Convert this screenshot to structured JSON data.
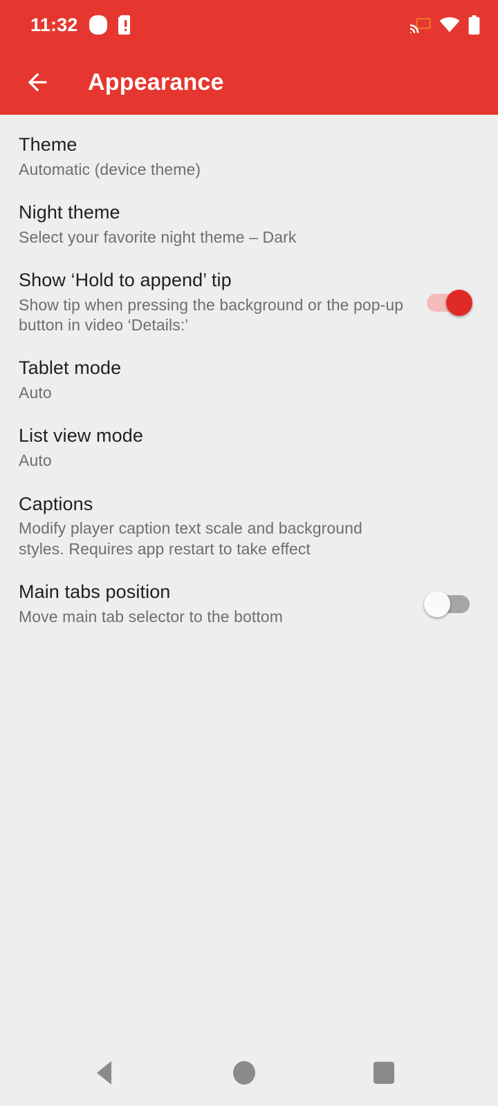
{
  "status_bar": {
    "time": "11:32",
    "icons_left": [
      "notification-blob-icon",
      "sdcard-alert-icon"
    ],
    "icons_right": [
      "cast-icon",
      "wifi-icon",
      "battery-icon"
    ],
    "background_color": "#e5372f",
    "cast_accent_color": "#f0702a"
  },
  "toolbar": {
    "back_icon": "arrow-left-icon",
    "title": "Appearance",
    "background_color": "#e5372f",
    "text_color": "#ffffff"
  },
  "preferences": [
    {
      "title": "Theme",
      "summary": "Automatic (device theme)",
      "widget": "none"
    },
    {
      "title": "Night theme",
      "summary": "Select your favorite night theme – Dark",
      "widget": "none"
    },
    {
      "title": "Show ‘Hold to append’ tip",
      "summary": "Show tip when pressing the background or the pop-up button in video ‘Details:’",
      "widget": "switch",
      "switch_state": "on"
    },
    {
      "title": "Tablet mode",
      "summary": "Auto",
      "widget": "none"
    },
    {
      "title": "List view mode",
      "summary": "Auto",
      "widget": "none"
    },
    {
      "title": "Captions",
      "summary": "Modify player caption text scale and background styles. Requires app restart to take effect",
      "widget": "none"
    },
    {
      "title": "Main tabs position",
      "summary": "Move main tab selector to the bottom",
      "widget": "switch",
      "switch_state": "off"
    }
  ],
  "nav_bar": {
    "back_icon": "triangle-back-icon",
    "home_icon": "circle-home-icon",
    "recents_icon": "square-recents-icon",
    "icon_color": "#8a8a8a"
  },
  "colors": {
    "accent": "#e5372f",
    "switch_on_thumb": "#e02a26",
    "switch_on_track": "#f3bcba",
    "switch_off_thumb": "#fafafa",
    "switch_off_track": "#a6a6a6",
    "page_background": "#eeeeee",
    "title_text": "#1f1f1f",
    "summary_text": "#6e6e6e"
  }
}
